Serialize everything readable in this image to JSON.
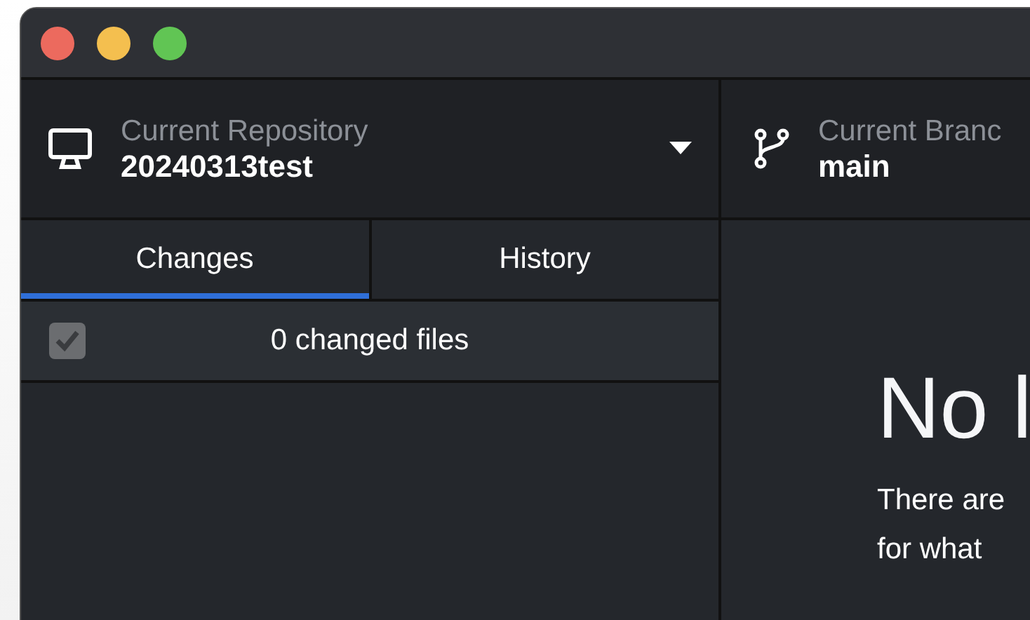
{
  "toolbar": {
    "repository": {
      "label": "Current Repository",
      "value": "20240313test"
    },
    "branch": {
      "label": "Current Branc",
      "value": "main"
    }
  },
  "tabs": [
    {
      "label": "Changes",
      "selected": true
    },
    {
      "label": "History",
      "selected": false
    }
  ],
  "changes_header": {
    "checked": true,
    "label": "0 changed files"
  },
  "empty_state": {
    "title": "No l",
    "lines": [
      "There are",
      "for what"
    ]
  }
}
